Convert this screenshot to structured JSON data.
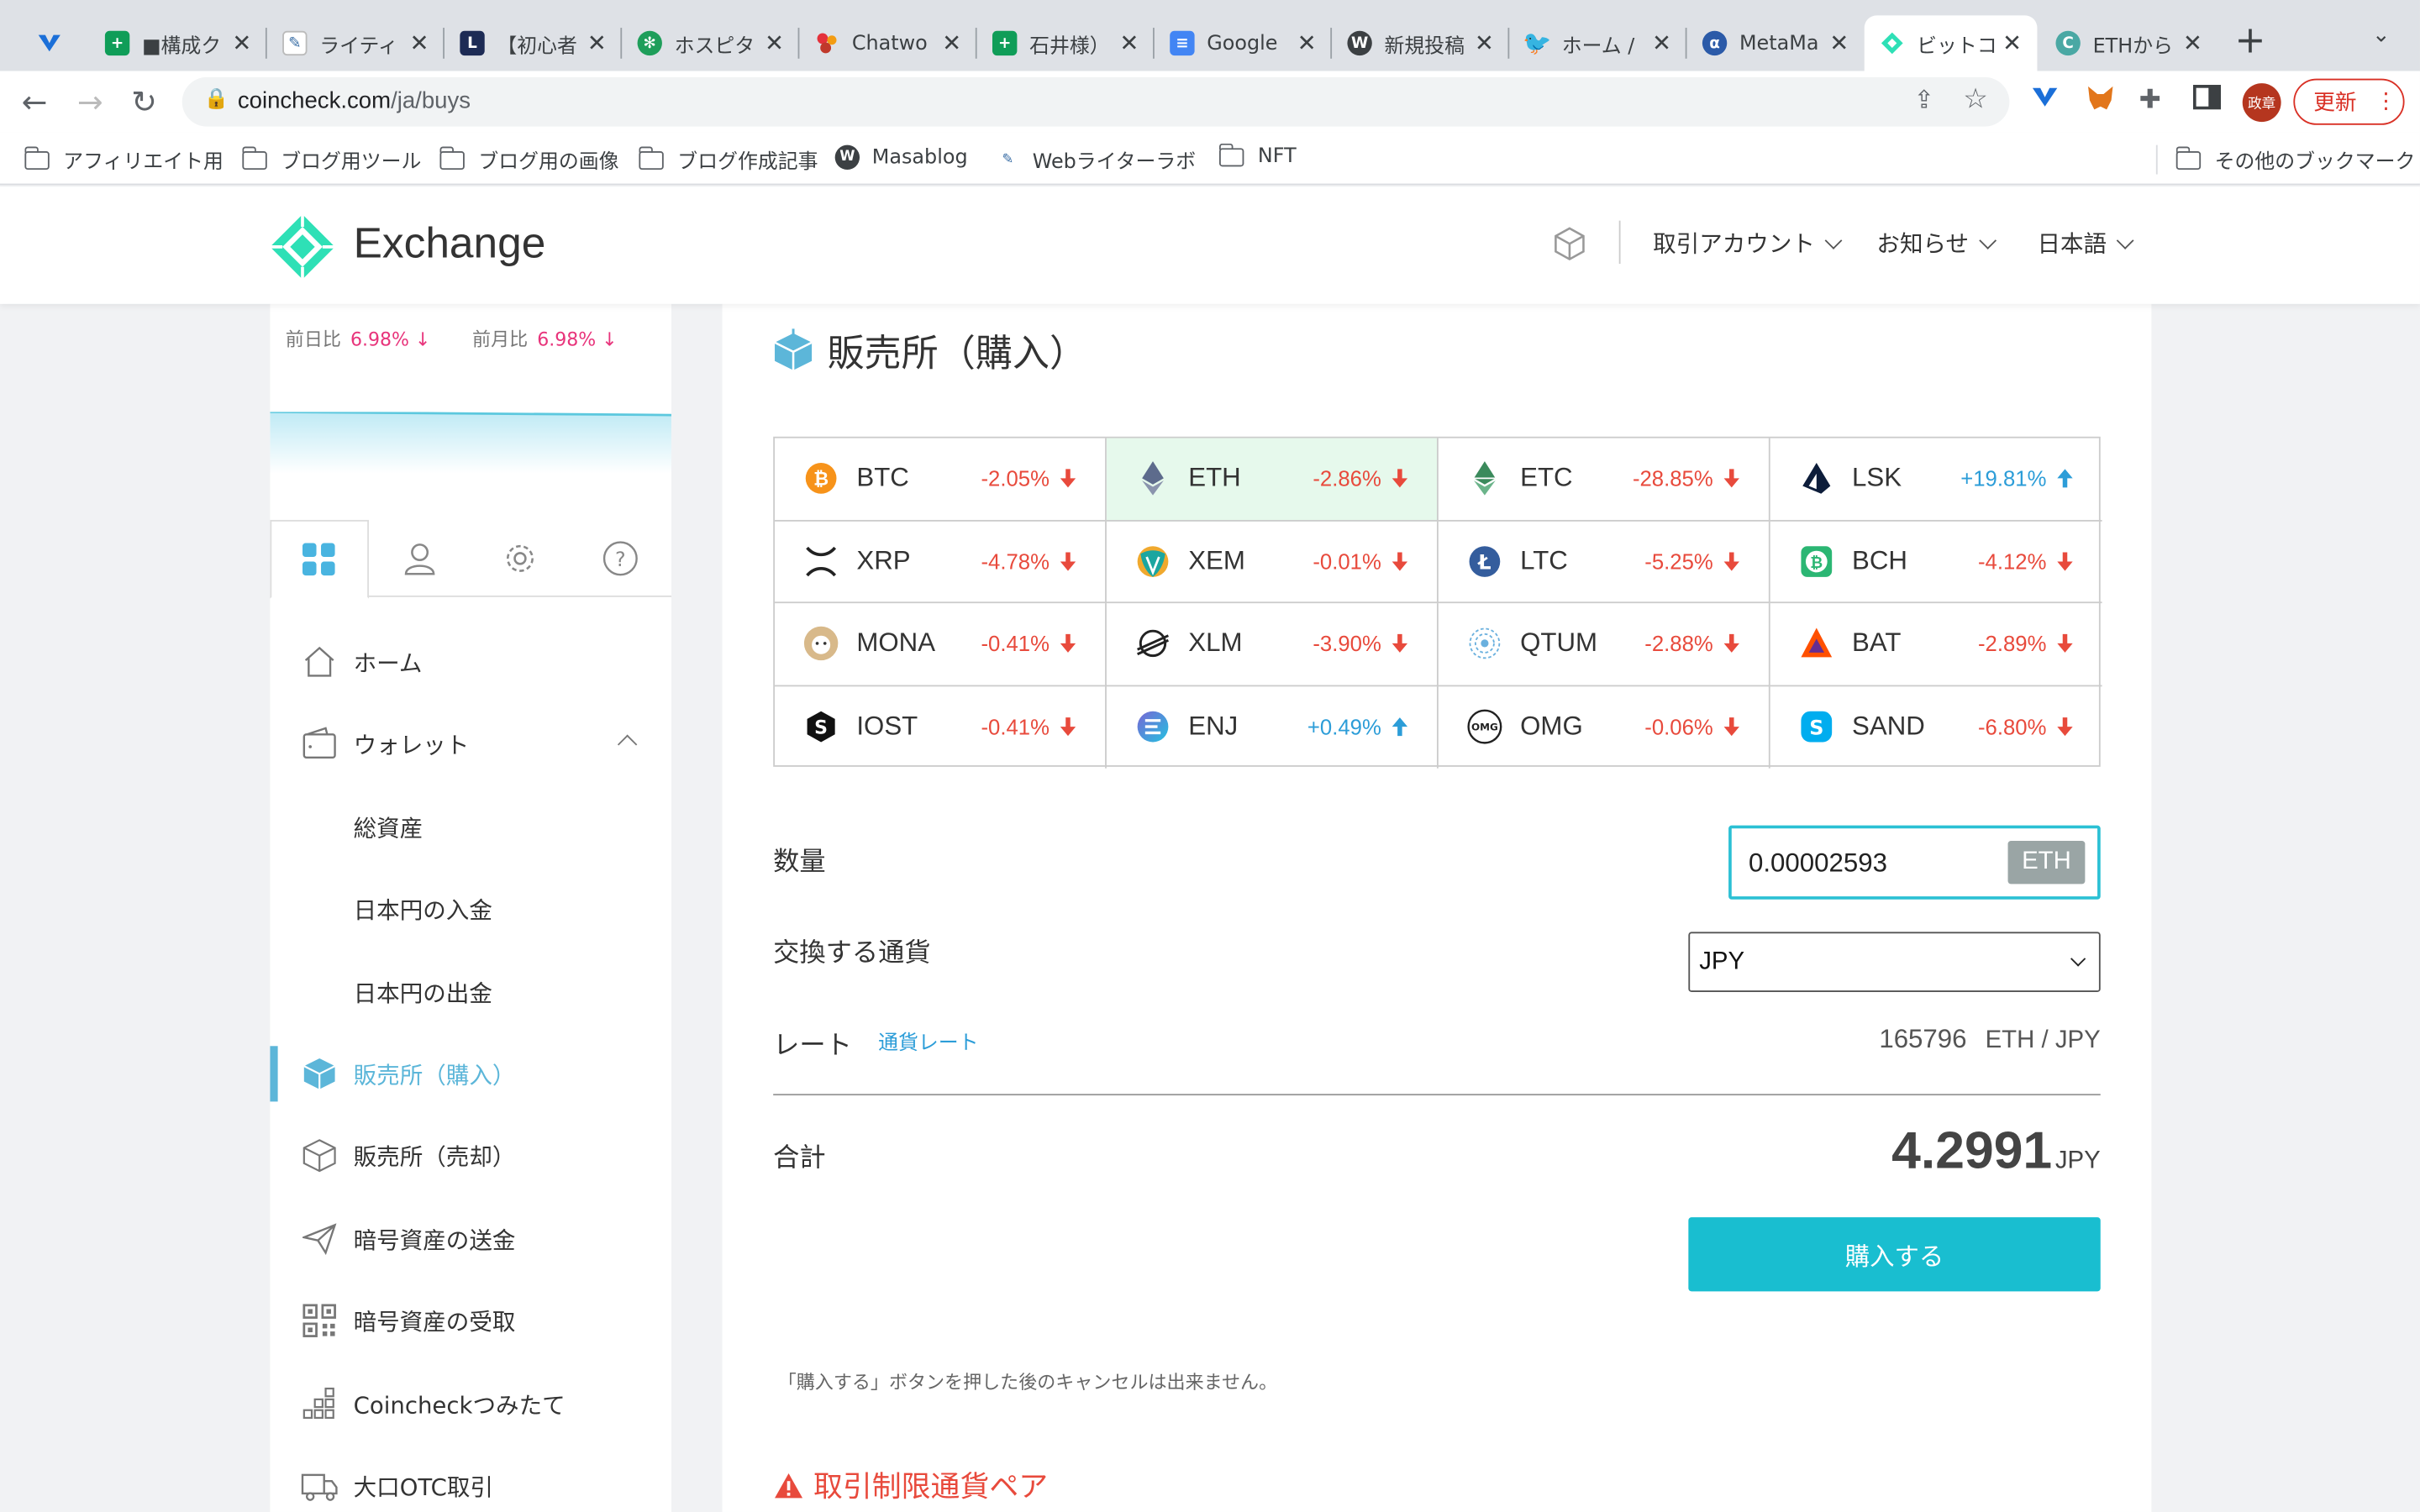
{
  "browser": {
    "tabs": [
      {
        "label": "",
        "icon": "vertex-icon"
      },
      {
        "label": "■構成ク",
        "icon": "sheets-icon"
      },
      {
        "label": "ライティ",
        "icon": "writer-icon"
      },
      {
        "label": "【初心者",
        "icon": "l-icon"
      },
      {
        "label": "ホスピタ",
        "icon": "flower-icon"
      },
      {
        "label": "Chatwo",
        "icon": "chatwork-icon"
      },
      {
        "label": "石井様）",
        "icon": "sheets-icon"
      },
      {
        "label": "Google",
        "icon": "docs-icon"
      },
      {
        "label": "新規投稿",
        "icon": "wordpress-icon"
      },
      {
        "label": "ホーム /",
        "icon": "twitter-icon"
      },
      {
        "label": "MetaMa",
        "icon": "alpha-icon"
      },
      {
        "label": "ビットコ",
        "icon": "coincheck-icon"
      },
      {
        "label": "ETHから",
        "icon": "c-icon"
      }
    ],
    "url_domain": "coincheck.com",
    "url_path": "/ja/buys",
    "profile_label": "政章",
    "update_label": "更新",
    "bookmarks": [
      {
        "label": "アフィリエイト用",
        "type": "folder"
      },
      {
        "label": "ブログ用ツール",
        "type": "folder"
      },
      {
        "label": "ブログ用の画像",
        "type": "folder"
      },
      {
        "label": "ブログ作成記事",
        "type": "folder"
      },
      {
        "label": "Masablog",
        "type": "wordpress"
      },
      {
        "label": "Webライターラボ",
        "type": "writer"
      },
      {
        "label": "NFT",
        "type": "folder"
      },
      {
        "label": "その他のブックマーク",
        "type": "folder"
      }
    ]
  },
  "site": {
    "logo_text": "Exchange",
    "menu": [
      "取引アカウント",
      "お知らせ",
      "日本語"
    ]
  },
  "sidebar": {
    "summary": {
      "day_label": "前日比",
      "day_pct": "6.98% ↓",
      "month_label": "前月比",
      "month_pct": "6.98% ↓"
    },
    "items": [
      {
        "label": "ホーム",
        "icon": "home-icon"
      },
      {
        "label": "ウォレット",
        "icon": "wallet-icon"
      },
      {
        "label": "総資産",
        "icon": ""
      },
      {
        "label": "日本円の入金",
        "icon": ""
      },
      {
        "label": "日本円の出金",
        "icon": ""
      },
      {
        "label": "販売所（購入）",
        "icon": "box-icon"
      },
      {
        "label": "販売所（売却）",
        "icon": "box-icon"
      },
      {
        "label": "暗号資産の送金",
        "icon": "send-icon"
      },
      {
        "label": "暗号資産の受取",
        "icon": "qr-icon"
      },
      {
        "label": "Coincheckつみたて",
        "icon": "stack-icon"
      },
      {
        "label": "大口OTC取引",
        "icon": "truck-icon"
      }
    ]
  },
  "main": {
    "title": "販売所（購入）",
    "coins": [
      {
        "symbol": "BTC",
        "change": "-2.05%",
        "dir": "down"
      },
      {
        "symbol": "ETH",
        "change": "-2.86%",
        "dir": "down"
      },
      {
        "symbol": "ETC",
        "change": "-28.85%",
        "dir": "down"
      },
      {
        "symbol": "LSK",
        "change": "+19.81%",
        "dir": "up"
      },
      {
        "symbol": "XRP",
        "change": "-4.78%",
        "dir": "down"
      },
      {
        "symbol": "XEM",
        "change": "-0.01%",
        "dir": "down"
      },
      {
        "symbol": "LTC",
        "change": "-5.25%",
        "dir": "down"
      },
      {
        "symbol": "BCH",
        "change": "-4.12%",
        "dir": "down"
      },
      {
        "symbol": "MONA",
        "change": "-0.41%",
        "dir": "down"
      },
      {
        "symbol": "XLM",
        "change": "-3.90%",
        "dir": "down"
      },
      {
        "symbol": "QTUM",
        "change": "-2.88%",
        "dir": "down"
      },
      {
        "symbol": "BAT",
        "change": "-2.89%",
        "dir": "down"
      },
      {
        "symbol": "IOST",
        "change": "-0.41%",
        "dir": "down"
      },
      {
        "symbol": "ENJ",
        "change": "+0.49%",
        "dir": "up"
      },
      {
        "symbol": "OMG",
        "change": "-0.06%",
        "dir": "down"
      },
      {
        "symbol": "SAND",
        "change": "-6.80%",
        "dir": "down"
      }
    ],
    "selected_coin": "ETH",
    "quantity_label": "数量",
    "quantity_value": "0.00002593",
    "quantity_unit": "ETH",
    "currency_label": "交換する通貨",
    "currency_value": "JPY",
    "rate_label": "レート",
    "rate_link": "通貨レート",
    "rate_value": "165796",
    "rate_pair": "ETH / JPY",
    "total_label": "合計",
    "total_value": "4.2991",
    "total_currency": "JPY",
    "buy_button": "購入する",
    "note": "「購入する」ボタンを押した後のキャンセルは出来ません。",
    "warning_title": "取引制限通貨ペア"
  },
  "colors": {
    "accent": "#19bed0",
    "down": "#e84a3c",
    "up": "#2c9dd8",
    "active_menu": "#5cb6d9"
  }
}
